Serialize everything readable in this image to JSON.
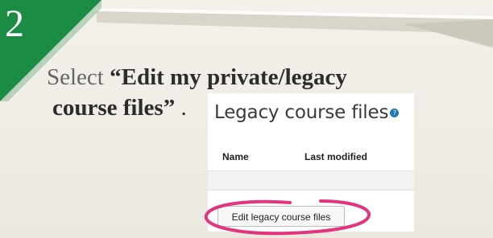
{
  "step": {
    "number": "2"
  },
  "instruction": {
    "verb": "Select",
    "target_line1": "“Edit my private/legacy",
    "target_line2": "course files”",
    "period": "."
  },
  "screenshot": {
    "title": "Legacy course files",
    "help_icon": "question-circle-icon",
    "columns": [
      "Name",
      "Last modified"
    ],
    "button_label": "Edit legacy course files"
  },
  "colors": {
    "badge_green": "#1e9046",
    "highlight_pink": "#e2357f"
  }
}
